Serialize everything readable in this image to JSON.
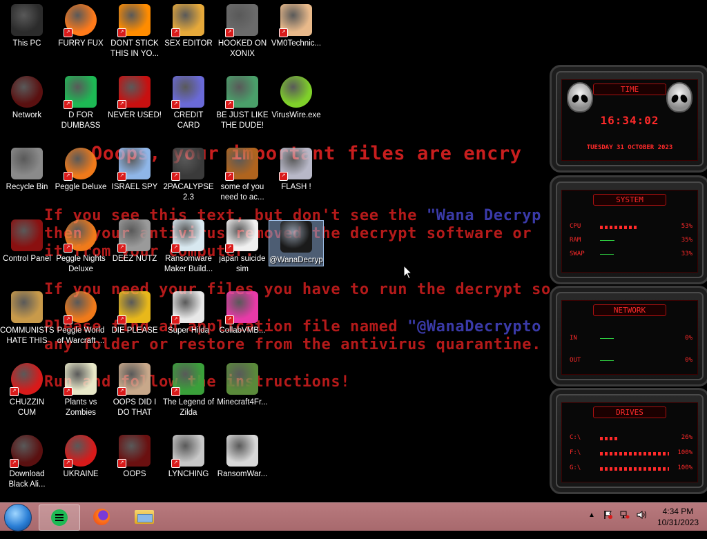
{
  "wallpaper": {
    "title": "Ooops, your important files are encry",
    "lines": [
      {
        "a": "If you see this text, but don't see the ",
        "b": "\"Wana Decryp"
      },
      {
        "a": "then your antivirus removed the decrypt software or",
        "b": ""
      },
      {
        "a": "it from your computer.",
        "b": ""
      },
      {
        "a": "If you need your files you have to run the decrypt so",
        "b": ""
      },
      {
        "a": "Please find an application file named ",
        "b": "\"@WanaDecrypto"
      },
      {
        "a": "any folder or restore from the antivirus quarantine.",
        "b": ""
      },
      {
        "a": "Run and follow the instructions!",
        "b": ""
      }
    ]
  },
  "icons": [
    {
      "id": "this-pc",
      "label": "This PC",
      "col": 0,
      "row": 0,
      "color": "#2b2b2b",
      "icon": "computer-icon",
      "badge": false
    },
    {
      "id": "furry-fux",
      "label": "FURRY FUX",
      "col": 1,
      "row": 0,
      "color": "#ff7a1a",
      "icon": "firefox-icon",
      "badge": true
    },
    {
      "id": "dont-stick",
      "label": "DONT STICK THIS IN YO...",
      "col": 2,
      "row": 0,
      "color": "#ff8c00",
      "icon": "traffic-cone-icon",
      "badge": true
    },
    {
      "id": "sex-editor",
      "label": "SEX EDITOR",
      "col": 3,
      "row": 0,
      "color": "#e6a93a",
      "icon": "hxd-icon",
      "badge": true
    },
    {
      "id": "hooked-on-xonix",
      "label": "HOOKED ON XONIX",
      "col": 4,
      "row": 0,
      "color": "#6b6b6b",
      "icon": "xonix-game-icon",
      "badge": true
    },
    {
      "id": "vm0technic",
      "label": "VM0Technic...",
      "col": 5,
      "row": 0,
      "color": "#e8b98a",
      "icon": "doctor-icon",
      "badge": true
    },
    {
      "id": "network",
      "label": "Network",
      "col": 0,
      "row": 1,
      "color": "#5a1010",
      "icon": "network-icon",
      "badge": false
    },
    {
      "id": "d-for-dumbass",
      "label": "D FOR DUMBASS",
      "col": 1,
      "row": 1,
      "color": "#1db954",
      "icon": "notes-app-icon",
      "badge": true
    },
    {
      "id": "never-used",
      "label": "NEVER USED!",
      "col": 2,
      "row": 1,
      "color": "#c81010",
      "icon": "dev-cpp-icon",
      "badge": true
    },
    {
      "id": "credit-card-checker",
      "label": "CREDIT CARD CHECKER",
      "col": 3,
      "row": 1,
      "color": "#6a6ad8",
      "icon": "credit-card-icon",
      "badge": true
    },
    {
      "id": "be-just-like-the-dude",
      "label": "BE JUST LIKE THE DUDE!",
      "col": 4,
      "row": 1,
      "color": "#4aa06a",
      "icon": "santa-icon",
      "badge": true
    },
    {
      "id": "viruswire",
      "label": "VirusWire.exe",
      "col": 5,
      "row": 1,
      "color": "#7fd02a",
      "icon": "lime-icon",
      "badge": false
    },
    {
      "id": "recycle-bin",
      "label": "Recycle Bin",
      "col": 0,
      "row": 2,
      "color": "#8a8a8a",
      "icon": "recycle-bin-icon",
      "badge": false
    },
    {
      "id": "peggle-deluxe",
      "label": "Peggle Deluxe",
      "col": 1,
      "row": 2,
      "color": "#f07a1a",
      "icon": "peggle-icon",
      "badge": true
    },
    {
      "id": "israel-spy",
      "label": "ISRAEL SPY",
      "col": 2,
      "row": 2,
      "color": "#8fb6e8",
      "icon": "remote-desktop-icon",
      "badge": true
    },
    {
      "id": "2pacalypse",
      "label": "2PACALYPSE 2.3",
      "col": 3,
      "row": 2,
      "color": "#3a3a3a",
      "icon": "terminal-icon",
      "badge": true
    },
    {
      "id": "some-of-you",
      "label": "some of you need to ac...",
      "col": 4,
      "row": 2,
      "color": "#b0641e",
      "icon": "scooby-doo-icon",
      "badge": true
    },
    {
      "id": "flash",
      "label": "FLASH !",
      "col": 5,
      "row": 2,
      "color": "#b8b8c8",
      "icon": "flash-icon",
      "badge": true
    },
    {
      "id": "control-panel",
      "label": "Control Panel",
      "col": 0,
      "row": 3,
      "color": "#8a1010",
      "icon": "control-panel-icon",
      "badge": false
    },
    {
      "id": "peggle-nights",
      "label": "Peggle Nights Deluxe",
      "col": 1,
      "row": 3,
      "color": "#f07a1a",
      "icon": "peggle-icon",
      "badge": true
    },
    {
      "id": "deez-nutz",
      "label": "DEEZ NUTZ",
      "col": 2,
      "row": 3,
      "color": "#9a9a9a",
      "icon": "window-stack-icon",
      "badge": true
    },
    {
      "id": "ransomware-maker",
      "label": "Ransomware Maker Build...",
      "col": 3,
      "row": 3,
      "color": "#d8e8f0",
      "icon": "app-window-icon",
      "badge": true
    },
    {
      "id": "japan-suicide-sim",
      "label": "japan suicide sim",
      "col": 4,
      "row": 3,
      "color": "#f0f0f0",
      "icon": "document-icon",
      "badge": true
    },
    {
      "id": "wanadecryptor-bmp",
      "label": "@WanaDecryptor@.bmp",
      "col": 5,
      "row": 3,
      "color": "#1a1a1a",
      "icon": "bitmap-icon",
      "badge": false,
      "selected": true
    },
    {
      "id": "communists",
      "label": "COMMUNISTS HATE THIS G...",
      "col": 0,
      "row": 4,
      "color": "#c89a4a",
      "icon": "money-bag-icon",
      "badge": false
    },
    {
      "id": "peggle-world",
      "label": "Peggle World of Warcraft ...",
      "col": 1,
      "row": 4,
      "color": "#f07a1a",
      "icon": "peggle-icon",
      "badge": true
    },
    {
      "id": "die-please",
      "label": "DIE PLEASE",
      "col": 2,
      "row": 4,
      "color": "#e8b81a",
      "icon": "de-icon",
      "badge": true
    },
    {
      "id": "super-hilda",
      "label": "Super Hilda",
      "col": 3,
      "row": 4,
      "color": "#e8e8e8",
      "icon": "pixel-character-icon",
      "badge": true
    },
    {
      "id": "collabvmb",
      "label": "CollabVMB...",
      "col": 4,
      "row": 4,
      "color": "#e83aa8",
      "icon": "monitor-icon",
      "badge": true
    },
    {
      "id": "chuzzin-cum",
      "label": "CHUZZIN CUM",
      "col": 0,
      "row": 5,
      "color": "#d81a1a",
      "icon": "chuzzle-icon",
      "badge": true
    },
    {
      "id": "plants-vs-zombies",
      "label": "Plants vs Zombies",
      "col": 1,
      "row": 5,
      "color": "#e8e8c8",
      "icon": "flower-icon",
      "badge": true
    },
    {
      "id": "oops-did-i-do-that",
      "label": "OOPS DID I DO THAT",
      "col": 2,
      "row": 5,
      "color": "#c8a88a",
      "icon": "portrait-icon",
      "badge": true
    },
    {
      "id": "legend-of-zilda",
      "label": "The Legend of Zilda",
      "col": 3,
      "row": 5,
      "color": "#3aa03a",
      "icon": "link-character-icon",
      "badge": true
    },
    {
      "id": "minecraft4fr",
      "label": "Minecraft4Fr...",
      "col": 4,
      "row": 5,
      "color": "#5a8a3a",
      "icon": "grass-block-icon",
      "badge": false
    },
    {
      "id": "download-black-ali",
      "label": "Download Black Ali...",
      "col": 0,
      "row": 6,
      "color": "#5a1010",
      "icon": "alien-network-icon",
      "badge": true
    },
    {
      "id": "ukraine",
      "label": "UKRAINE",
      "col": 1,
      "row": 6,
      "color": "#d81a1a",
      "icon": "radiation-icon",
      "badge": true
    },
    {
      "id": "oops",
      "label": "OOPS",
      "col": 2,
      "row": 6,
      "color": "#6a1010",
      "icon": "alien-head-icon",
      "badge": true
    },
    {
      "id": "lynching",
      "label": "LYNCHING",
      "col": 3,
      "row": 6,
      "color": "#c8c8c8",
      "icon": "zipper-icon",
      "badge": true
    },
    {
      "id": "ransomwar",
      "label": "RansomWar...",
      "col": 4,
      "row": 6,
      "color": "#d8d8d8",
      "icon": "skull-icon",
      "badge": false
    }
  ],
  "widgets": {
    "time": {
      "title": "TIME",
      "clock": "16:34:02",
      "date": "TUESDAY 31 OCTOBER 2023"
    },
    "system": {
      "title": "SYSTEM",
      "rows": [
        {
          "key": "CPU",
          "value": "53%",
          "level": 0.53,
          "kind": "red"
        },
        {
          "key": "RAM",
          "value": "35%",
          "level": 0.35,
          "kind": "green"
        },
        {
          "key": "SWAP",
          "value": "33%",
          "level": 0.33,
          "kind": "green"
        }
      ]
    },
    "network": {
      "title": "NETWORK",
      "rows": [
        {
          "key": "IN",
          "value": "0%",
          "level": 0,
          "kind": "green"
        },
        {
          "key": "OUT",
          "value": "0%",
          "level": 0,
          "kind": "green"
        }
      ]
    },
    "drives": {
      "title": "DRIVES",
      "rows": [
        {
          "key": "C:\\",
          "value": "26%",
          "level": 0.26,
          "kind": "red"
        },
        {
          "key": "F:\\",
          "value": "100%",
          "level": 1.0,
          "kind": "red"
        },
        {
          "key": "G:\\",
          "value": "100%",
          "level": 1.0,
          "kind": "red"
        }
      ]
    }
  },
  "taskbar": {
    "start_icon": "start-orb-icon",
    "apps": [
      {
        "id": "notes",
        "icon": "notes-app-icon",
        "active": true,
        "color": "#1db954"
      },
      {
        "id": "firefox",
        "icon": "firefox-icon",
        "active": false,
        "color": "#ff7a1a"
      },
      {
        "id": "explorer",
        "icon": "file-explorer-icon",
        "active": false,
        "color": "#f0c040"
      }
    ],
    "tray": {
      "time": "4:34 PM",
      "date": "10/31/2023"
    }
  },
  "colors": {
    "accent": "#ff2a2a",
    "taskbar": "#b07275",
    "ransom_text": "#b41a1a"
  }
}
